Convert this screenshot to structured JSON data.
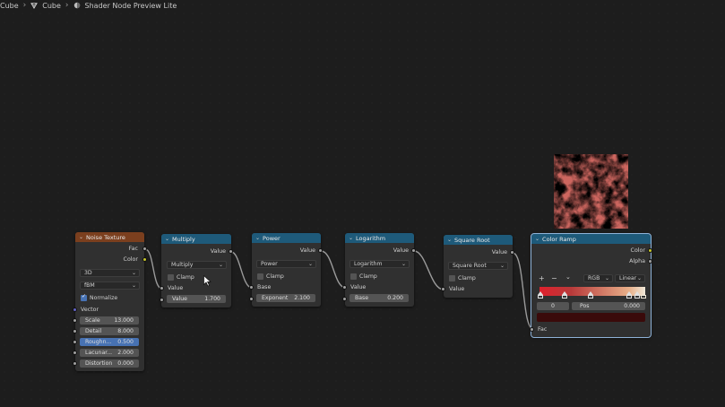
{
  "breadcrumb": [
    "Cube",
    "Cube",
    "Shader Node Preview Lite"
  ],
  "nodes": {
    "noise": {
      "title": "Noise Texture",
      "outputs": [
        "Fac",
        "Color"
      ],
      "dimension": "3D",
      "type": "fBM",
      "normalize_label": "Normalize",
      "normalize_checked": true,
      "vector_label": "Vector",
      "fields": [
        {
          "label": "Scale",
          "value": "13.000"
        },
        {
          "label": "Detail",
          "value": "8.000"
        },
        {
          "label": "Roughn...",
          "value": "0.500"
        },
        {
          "label": "Lacunar...",
          "value": "2.000"
        },
        {
          "label": "Distortion",
          "value": "0.000"
        }
      ]
    },
    "multiply": {
      "title": "Multiply",
      "output": "Value",
      "op": "Multiply",
      "clamp": "Clamp",
      "input": "Value",
      "field": {
        "label": "Value",
        "value": "1.700"
      }
    },
    "power": {
      "title": "Power",
      "output": "Value",
      "op": "Power",
      "clamp": "Clamp",
      "input": "Base",
      "field": {
        "label": "Exponent",
        "value": "2.100"
      }
    },
    "log": {
      "title": "Logarithm",
      "output": "Value",
      "op": "Logarithm",
      "clamp": "Clamp",
      "input": "Value",
      "field": {
        "label": "Base",
        "value": "0.200"
      }
    },
    "sqrt": {
      "title": "Square Root",
      "output": "Value",
      "op": "Square Root",
      "clamp": "Clamp",
      "input": "Value"
    },
    "ramp": {
      "title": "Color Ramp",
      "outputs": [
        "Color",
        "Alpha"
      ],
      "add": "+",
      "remove": "−",
      "menu": "⌄",
      "mode": "RGB",
      "interp": "Linear",
      "index": "0",
      "pos_label": "Pos",
      "pos_value": "0.000",
      "input": "Fac"
    }
  },
  "colors": {
    "texture_header": "#7b3f1e",
    "converter_header": "#1e5a7a",
    "float_socket": "#a1a1a1",
    "color_socket": "#c7c729",
    "vector_socket": "#6363c7"
  }
}
